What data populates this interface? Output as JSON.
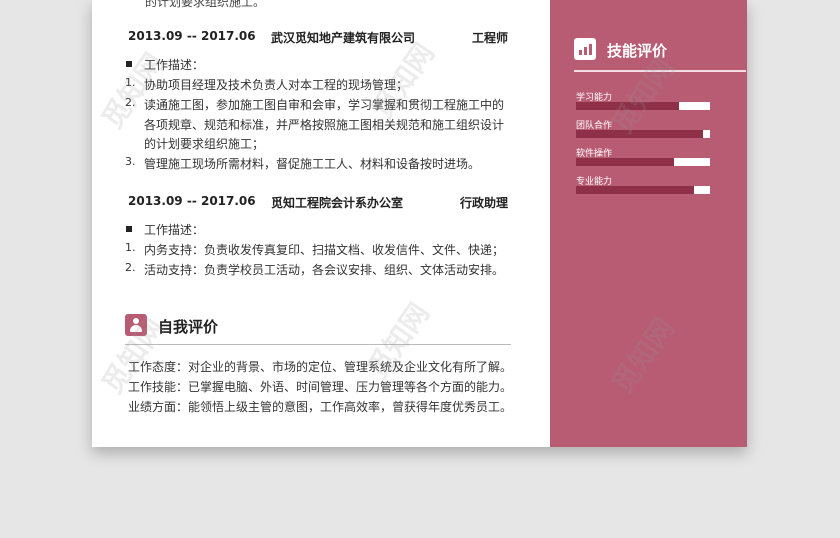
{
  "experience": {
    "top_fragment": "的计划要求组织施工。",
    "jobs": [
      {
        "date": "2013.09 -- 2017.06",
        "company": "武汉觅知地产建筑有限公司",
        "role": "工程师",
        "desc_label": "工作描述：",
        "items": [
          {
            "num": "1.",
            "lines": [
              "协助项目经理及技术负责人对本工程的现场管理；"
            ]
          },
          {
            "num": "2.",
            "lines": [
              "读通施工图，参加施工图自审和会审，学习掌握和贯彻工程施工中的",
              "各项规章、规范和标准，并严格按照施工图相关规范和施工组织设计",
              "的计划要求组织施工；"
            ]
          },
          {
            "num": "3.",
            "lines": [
              "管理施工现场所需材料，督促施工工人、材料和设备按时进场。"
            ]
          }
        ]
      },
      {
        "date": "2013.09 -- 2017.06",
        "company": "觅知工程院会计系办公室",
        "role": "行政助理",
        "desc_label": "工作描述：",
        "items": [
          {
            "num": "1.",
            "lines": [
              "内务支持：负责收发传真复印、扫描文档、收发信件、文件、快递；"
            ]
          },
          {
            "num": "2.",
            "lines": [
              "活动支持：负责学校员工活动，各会议安排、组织、文体活动安排。"
            ]
          }
        ]
      }
    ]
  },
  "self_eval": {
    "title": "自我评价",
    "icon": "person-icon",
    "lines": [
      "工作态度：对企业的背景、市场的定位、管理系统及企业文化有所了解。",
      "工作技能：已掌握电脑、外语、时间管理、压力管理等各个方面的能力。",
      "业绩方面：能领悟上级主管的意图，工作高效率，曾获得年度优秀员工。"
    ]
  },
  "skills": {
    "title": "技能评价",
    "icon": "bar-chart-icon",
    "items": [
      {
        "label": "学习能力",
        "level": 0.77
      },
      {
        "label": "团队合作",
        "level": 0.95
      },
      {
        "label": "软件操作",
        "level": 0.73
      },
      {
        "label": "专业能力",
        "level": 0.88
      }
    ]
  },
  "watermark": "觅知网",
  "colors": {
    "accent": "#b85c74",
    "bar_fill": "#8e3148",
    "bar_track": "#ffffff"
  }
}
